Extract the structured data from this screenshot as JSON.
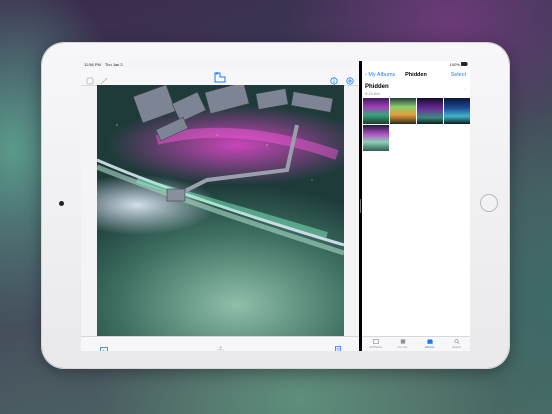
{
  "device": {
    "status_time": "11:56 PM",
    "status_date": "Thu Jan 2",
    "battery": "100%"
  },
  "photos_app": {
    "toolbar_icons": [
      "sticker-icon",
      "magic-wand-icon",
      "photos-app-icon",
      "info-icon",
      "add-icon"
    ],
    "bottom_icons": [
      "image-icon",
      "share-icon",
      "document-icon"
    ],
    "photo_subject": "aurora-from-space-station"
  },
  "album": {
    "back_label": "My Albums",
    "title": "Phidden",
    "select_label": "Select",
    "header": "Phidden",
    "subtitle": "9:43 AM",
    "thumbnails": [
      "aurora-green-purple",
      "aurora-orange-green",
      "aurora-purple",
      "aurora-blue",
      "space-station-aurora"
    ]
  },
  "tabs": [
    {
      "label": "All Photos",
      "icon": "photos-icon",
      "active": false
    },
    {
      "label": "For You",
      "icon": "for-you-icon",
      "active": false
    },
    {
      "label": "Albums",
      "icon": "albums-icon",
      "active": true
    },
    {
      "label": "Search",
      "icon": "search-icon",
      "active": false
    }
  ],
  "colors": {
    "accent": "#1a7cf5",
    "aurora_pink": "#d84ad0",
    "aurora_green": "#7fbfa5"
  }
}
